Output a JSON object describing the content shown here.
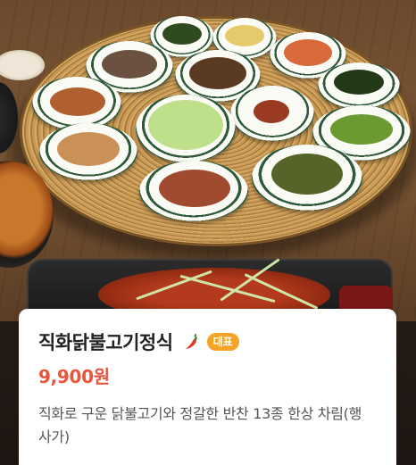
{
  "menu_item": {
    "name": "직화닭불고기정식",
    "badge": "대표",
    "price": "9,900원",
    "description": "직화로 구운 닭불고기와 정갈한 반찬 13종 한상 차림(행사가)",
    "spicy_icon": "chili-pepper-icon"
  },
  "colors": {
    "price": "#e8553a",
    "badge_bg": "#f5a425",
    "title": "#222222",
    "description": "#555555"
  }
}
